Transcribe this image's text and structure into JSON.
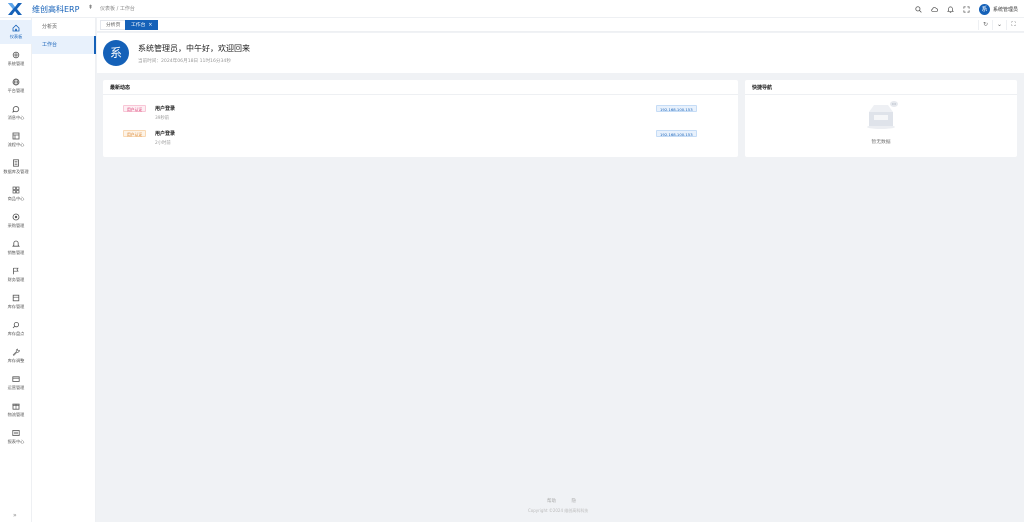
{
  "app": {
    "title": "维创高科ERP"
  },
  "header": {
    "breadcrumb": [
      "仪表板",
      "/",
      "工作台"
    ],
    "user_avatar_text": "系",
    "user_name": "系统管理员"
  },
  "sidebar": {
    "items": [
      {
        "label": "仪表板",
        "icon": "home-icon"
      },
      {
        "label": "系统管理",
        "icon": "gear-icon"
      },
      {
        "label": "平台管理",
        "icon": "globe-icon"
      },
      {
        "label": "消息中心",
        "icon": "chat-icon"
      },
      {
        "label": "流程中心",
        "icon": "flow-icon"
      },
      {
        "label": "数据库及管理",
        "icon": "database-icon"
      },
      {
        "label": "商品中心",
        "icon": "grid-icon"
      },
      {
        "label": "采购管理",
        "icon": "purchase-icon"
      },
      {
        "label": "销售管理",
        "icon": "bell-icon"
      },
      {
        "label": "财务管理",
        "icon": "flag-icon"
      },
      {
        "label": "库存管理",
        "icon": "box-icon"
      },
      {
        "label": "库存盘点",
        "icon": "search-icon"
      },
      {
        "label": "库存调整",
        "icon": "wrench-icon"
      },
      {
        "label": "运营管理",
        "icon": "card-icon"
      },
      {
        "label": "物流管理",
        "icon": "gift-icon"
      },
      {
        "label": "报表中心",
        "icon": "report-icon"
      }
    ],
    "collapse_label": "»"
  },
  "subnav": {
    "items": [
      {
        "label": "分析页"
      },
      {
        "label": "工作台"
      }
    ]
  },
  "tabs": {
    "items": [
      {
        "label": "分析页"
      },
      {
        "label": "工作台",
        "close": "×"
      }
    ],
    "tools": [
      "↻",
      "⌄",
      "⛶"
    ]
  },
  "welcome": {
    "avatar_text": "系",
    "greeting": "系统管理员，中午好，欢迎回来",
    "time_text": "当前时间：2024年06月18日 11时16分34秒"
  },
  "activity": {
    "title": "最新动态",
    "rows": [
      {
        "tag": "用户认证",
        "tag_color": "pink",
        "title": "用户登录",
        "time": "39秒前",
        "ip": "192.168.100.153"
      },
      {
        "tag": "用户认证",
        "tag_color": "orange",
        "title": "用户登录",
        "time": "2小时前",
        "ip": "192.168.100.153"
      }
    ]
  },
  "quick_nav": {
    "title": "快捷导航",
    "empty_text": "暂无数据"
  },
  "footer": {
    "links": [
      "帮助",
      "隐"
    ],
    "copyright": "Copyright ©2024 维创高科科技"
  },
  "colors": {
    "brand": "#1561b8",
    "active_bg": "#e8f1fc"
  }
}
